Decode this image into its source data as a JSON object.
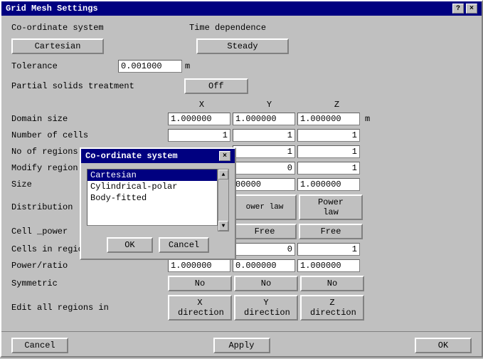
{
  "window": {
    "title": "Grid Mesh Settings",
    "help_btn": "?",
    "close_btn": "×"
  },
  "sections": {
    "coordinate_label": "Co-ordinate system",
    "time_label": "Time dependence",
    "coordinate_btn": "Cartesian",
    "steady_btn": "Steady",
    "tolerance_label": "Tolerance",
    "tolerance_value": "0.001000",
    "tolerance_unit": "m",
    "partial_label": "Partial solids treatment",
    "partial_btn": "Off",
    "xyz": {
      "x": "X",
      "y": "Y",
      "z": "Z"
    },
    "domain_label": "Domain size",
    "domain_x": "1.000000",
    "domain_y": "1.000000",
    "domain_z": "1.000000",
    "domain_unit": "m",
    "cells_label": "Number of cells",
    "cells_x": "1",
    "cells_y": "1",
    "cells_z": "1",
    "regions_label": "No of regions",
    "regions_y": "1",
    "regions_z": "1",
    "modify_label": "Modify region",
    "modify_y": "0",
    "modify_z": "1",
    "size_label": "Size",
    "size_y": "00000",
    "size_z": "1.000000",
    "distribution_label": "Distribution",
    "distribution_y": "ower law",
    "distribution_z": "Power law",
    "cell_power_label": "Cell _power",
    "cell_power_y": "Free",
    "cell_power_z": "Free",
    "cells_region_label": "Cells in region",
    "cells_region_y": "0",
    "cells_region_z": "1",
    "power_label": "Power/ratio",
    "power_x": "1.000000",
    "power_y": "0.000000",
    "power_z": "1.000000",
    "symmetric_label": "Symmetric",
    "symmetric_x": "No",
    "symmetric_y": "No",
    "symmetric_z": "No",
    "edit_label": "Edit all regions in",
    "edit_x": "X direction",
    "edit_y": "Y direction",
    "edit_z": "Z direction"
  },
  "popup": {
    "title": "Co-ordinate system",
    "close_btn": "×",
    "items": [
      "Cartesian",
      "Cylindrical-polar",
      "Body-fitted"
    ],
    "selected": 0,
    "ok_btn": "OK",
    "cancel_btn": "Cancel"
  },
  "bottom": {
    "cancel_btn": "Cancel",
    "apply_btn": "Apply",
    "ok_btn": "OK"
  }
}
